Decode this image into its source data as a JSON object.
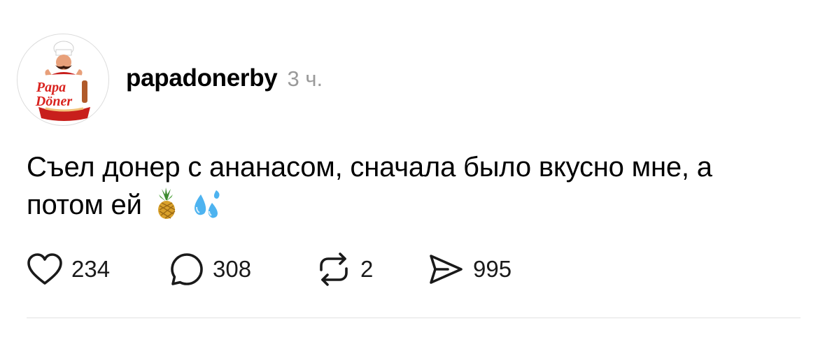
{
  "post": {
    "avatar_icon": "papa-doner-logo",
    "avatar_text_line1": "Papa",
    "avatar_text_line2": "Döner",
    "username": "papadonerby",
    "timestamp": "3 ч.",
    "text": "Съел донер с ананасом, сначала было вкусно мне, а потом ей",
    "emojis": [
      "pineapple-emoji",
      "sweat-droplets-emoji"
    ]
  },
  "actions": {
    "likes": {
      "icon": "heart-icon",
      "count": "234"
    },
    "comments": {
      "icon": "comment-bubble-icon",
      "count": "308"
    },
    "reposts": {
      "icon": "repost-icon",
      "count": "2"
    },
    "shares": {
      "icon": "send-icon",
      "count": "995"
    }
  },
  "colors": {
    "text": "#000000",
    "muted": "#9a9a9a",
    "brand_red": "#d9231f",
    "divider": "#e2e2e2"
  }
}
